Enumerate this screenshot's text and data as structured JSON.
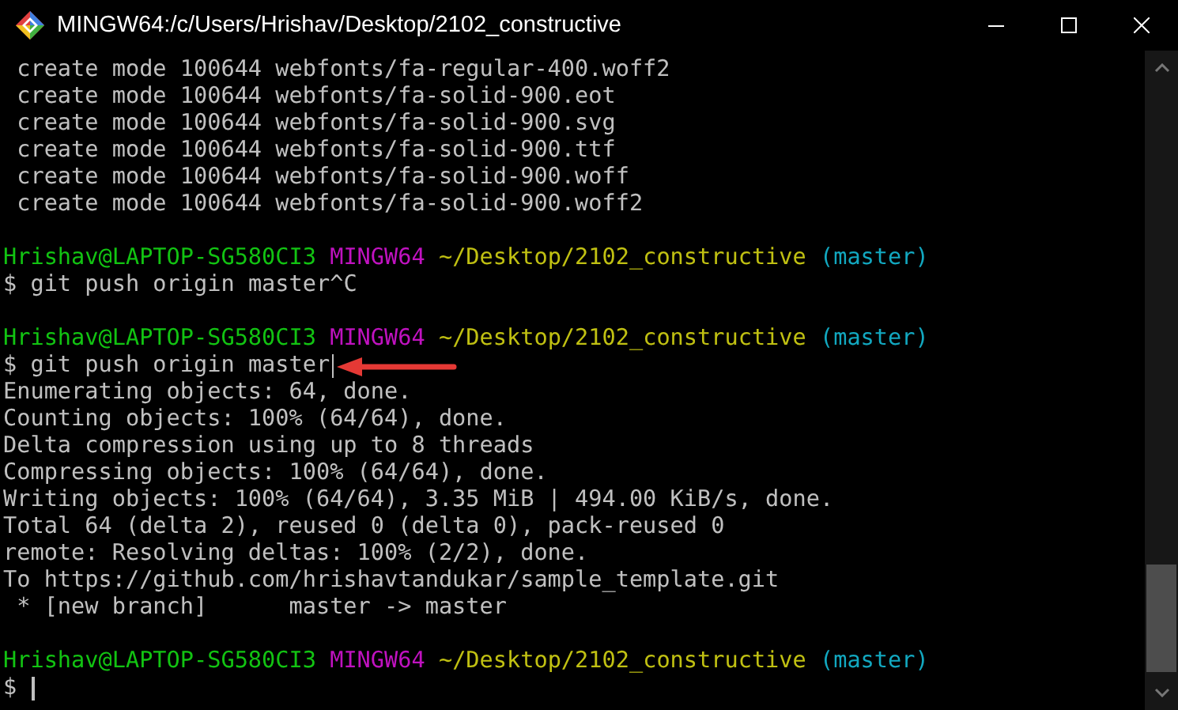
{
  "window": {
    "title": "MINGW64:/c/Users/Hrishav/Desktop/2102_constructive"
  },
  "terminal": {
    "lines": [
      {
        "kind": "output",
        "text": " create mode 100644 webfonts/fa-regular-400.woff2"
      },
      {
        "kind": "output",
        "text": " create mode 100644 webfonts/fa-solid-900.eot"
      },
      {
        "kind": "output",
        "text": " create mode 100644 webfonts/fa-solid-900.svg"
      },
      {
        "kind": "output",
        "text": " create mode 100644 webfonts/fa-solid-900.ttf"
      },
      {
        "kind": "output",
        "text": " create mode 100644 webfonts/fa-solid-900.woff"
      },
      {
        "kind": "output",
        "text": " create mode 100644 webfonts/fa-solid-900.woff2"
      },
      {
        "kind": "blank"
      },
      {
        "kind": "prompt",
        "user": "Hrishav@LAPTOP-SG580CI3",
        "system": "MINGW64",
        "path": "~/Desktop/2102_constructive",
        "branch": "(master)"
      },
      {
        "kind": "command",
        "prompt": "$",
        "text": "git push origin master^C",
        "cursor": false,
        "arrow": false
      },
      {
        "kind": "blank"
      },
      {
        "kind": "prompt",
        "user": "Hrishav@LAPTOP-SG580CI3",
        "system": "MINGW64",
        "path": "~/Desktop/2102_constructive",
        "branch": "(master)"
      },
      {
        "kind": "command",
        "prompt": "$",
        "text": "git push origin master",
        "cursor": true,
        "arrow": true
      },
      {
        "kind": "output",
        "text": "Enumerating objects: 64, done."
      },
      {
        "kind": "output",
        "text": "Counting objects: 100% (64/64), done."
      },
      {
        "kind": "output",
        "text": "Delta compression using up to 8 threads"
      },
      {
        "kind": "output",
        "text": "Compressing objects: 100% (64/64), done."
      },
      {
        "kind": "output",
        "text": "Writing objects: 100% (64/64), 3.35 MiB | 494.00 KiB/s, done."
      },
      {
        "kind": "output",
        "text": "Total 64 (delta 2), reused 0 (delta 0), pack-reused 0"
      },
      {
        "kind": "output",
        "text": "remote: Resolving deltas: 100% (2/2), done."
      },
      {
        "kind": "output",
        "text": "To https://github.com/hrishavtandukar/sample_template.git"
      },
      {
        "kind": "output",
        "text": " * [new branch]      master -> master"
      },
      {
        "kind": "blank"
      },
      {
        "kind": "prompt",
        "user": "Hrishav@LAPTOP-SG580CI3",
        "system": "MINGW64",
        "path": "~/Desktop/2102_constructive",
        "branch": "(master)"
      },
      {
        "kind": "command",
        "prompt": "$",
        "cursor": true,
        "arrow": false
      }
    ]
  }
}
